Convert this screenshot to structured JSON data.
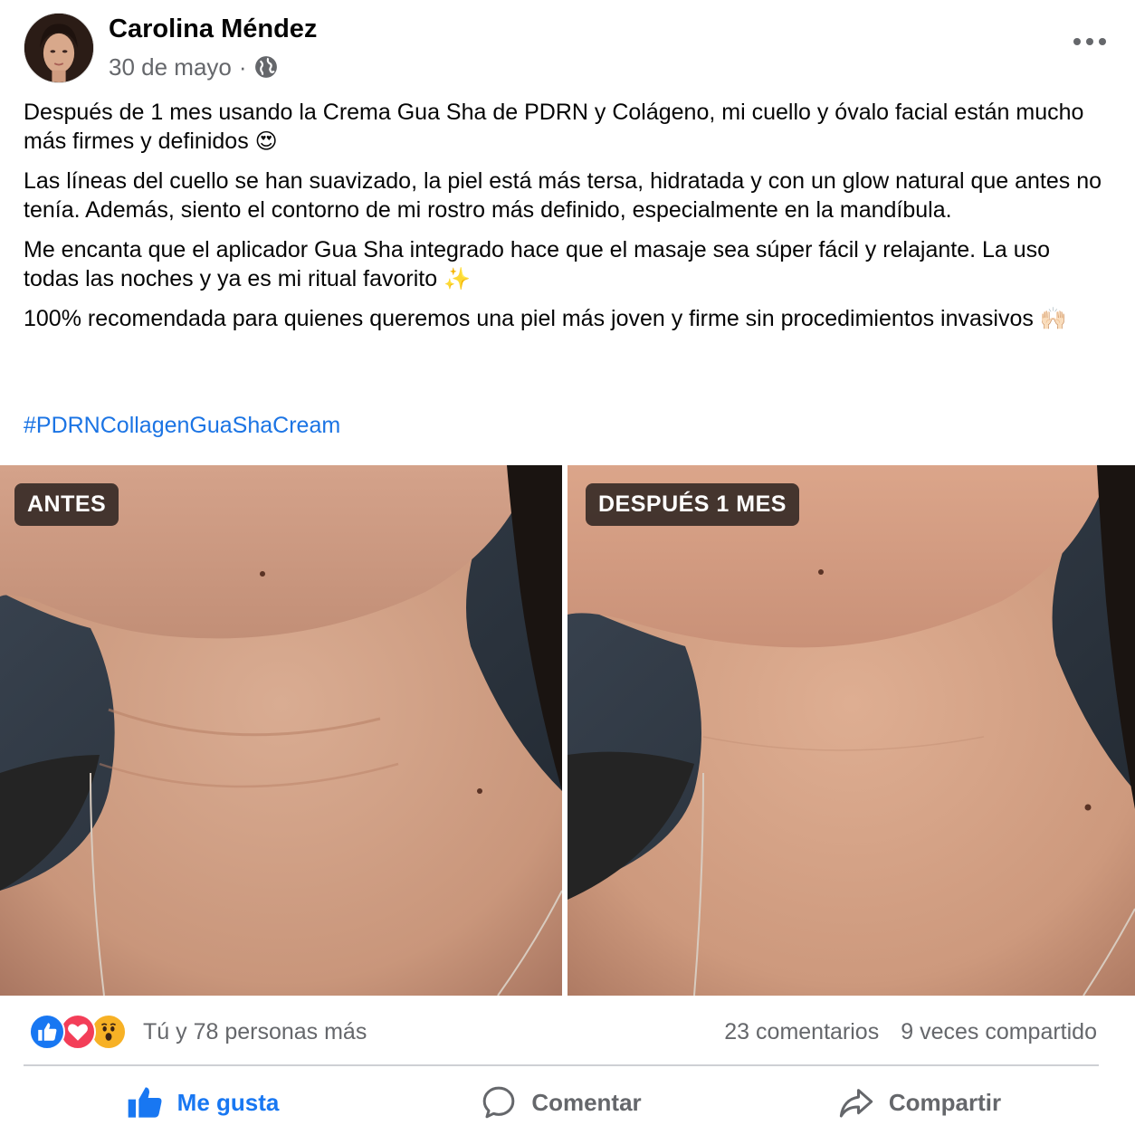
{
  "post": {
    "author": "Carolina Méndez",
    "date": "30 de mayo",
    "separator": "·",
    "paragraphs": [
      {
        "text": "Después de 1 mes usando la Crema Gua Sha de PDRN y Colágeno, mi cuello y óvalo facial están mucho más firmes y definidos",
        "emoji": "😍"
      },
      {
        "text": "Las líneas del cuello se han suavizado, la piel está más tersa, hidratada y con un glow natural que antes no tenía. Además, siento el contorno de mi rostro más definido, especialmente en la mandíbula.",
        "emoji": ""
      },
      {
        "text": "Me encanta que el aplicador Gua Sha integrado hace que el masaje sea súper fácil y relajante. La uso todas las noches y ya es mi ritual favorito",
        "emoji": "✨"
      },
      {
        "text": "100% recomendada para quienes queremos una piel más joven y firme sin procedimientos invasivos",
        "emoji": "🙌🏻"
      }
    ],
    "hashtag": "#PDRNCollagenGuaShaCream",
    "photos": {
      "before_label": "ANTES",
      "after_label": "DESPUÉS 1 MES"
    }
  },
  "stats": {
    "reactions_text": "Tú y 78 personas más",
    "comments": "23 comentarios",
    "shares": "9 veces compartido",
    "reaction_icons": [
      "like-icon",
      "love-icon",
      "wow-icon"
    ]
  },
  "actions": {
    "like": "Me gusta",
    "comment": "Comentar",
    "share": "Compartir"
  },
  "colors": {
    "link": "#1b74e4",
    "like_active": "#1877f2",
    "secondary_text": "#65676b"
  }
}
